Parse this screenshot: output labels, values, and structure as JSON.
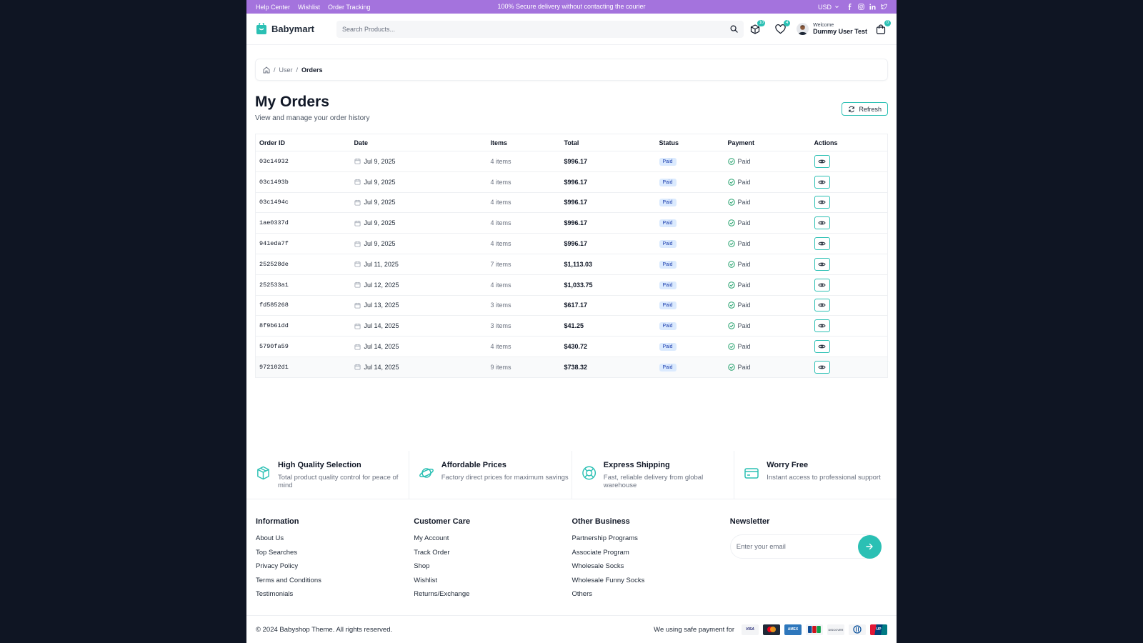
{
  "topbar": {
    "links": [
      "Help Center",
      "Wishlist",
      "Order Tracking"
    ],
    "promo": "100% Secure delivery without contacting the courier",
    "currency": "USD",
    "socials": [
      "facebook-icon",
      "instagram-icon",
      "linkedin-icon",
      "twitter-icon"
    ]
  },
  "header": {
    "logo": "Babymart",
    "search_placeholder": "Search Products...",
    "compare_count": "10",
    "wishlist_count": "4",
    "cart_count": "0",
    "welcome": "Welcome",
    "user_name": "Dummy User Test"
  },
  "breadcrumb": {
    "home_icon": "home-icon",
    "user": "User",
    "current": "Orders"
  },
  "page": {
    "title": "My Orders",
    "subtitle": "View and manage your order history",
    "refresh_label": "Refresh"
  },
  "table": {
    "headers": [
      "Order ID",
      "Date",
      "Items",
      "Total",
      "Status",
      "Payment",
      "Actions"
    ],
    "rows": [
      {
        "id": "03c14932",
        "date": "Jul 9, 2025",
        "items": "4 items",
        "total": "$996.17",
        "status": "Paid",
        "payment": "Paid"
      },
      {
        "id": "03c1493b",
        "date": "Jul 9, 2025",
        "items": "4 items",
        "total": "$996.17",
        "status": "Paid",
        "payment": "Paid"
      },
      {
        "id": "03c1494c",
        "date": "Jul 9, 2025",
        "items": "4 items",
        "total": "$996.17",
        "status": "Paid",
        "payment": "Paid"
      },
      {
        "id": "1ae0337d",
        "date": "Jul 9, 2025",
        "items": "4 items",
        "total": "$996.17",
        "status": "Paid",
        "payment": "Paid"
      },
      {
        "id": "941eda7f",
        "date": "Jul 9, 2025",
        "items": "4 items",
        "total": "$996.17",
        "status": "Paid",
        "payment": "Paid"
      },
      {
        "id": "252528de",
        "date": "Jul 11, 2025",
        "items": "7 items",
        "total": "$1,113.03",
        "status": "Paid",
        "payment": "Paid"
      },
      {
        "id": "252533a1",
        "date": "Jul 12, 2025",
        "items": "4 items",
        "total": "$1,033.75",
        "status": "Paid",
        "payment": "Paid"
      },
      {
        "id": "fd585268",
        "date": "Jul 13, 2025",
        "items": "3 items",
        "total": "$617.17",
        "status": "Paid",
        "payment": "Paid"
      },
      {
        "id": "8f9b61dd",
        "date": "Jul 14, 2025",
        "items": "3 items",
        "total": "$41.25",
        "status": "Paid",
        "payment": "Paid"
      },
      {
        "id": "5790fa59",
        "date": "Jul 14, 2025",
        "items": "4 items",
        "total": "$430.72",
        "status": "Paid",
        "payment": "Paid"
      },
      {
        "id": "972102d1",
        "date": "Jul 14, 2025",
        "items": "9 items",
        "total": "$738.32",
        "status": "Paid",
        "payment": "Paid"
      }
    ]
  },
  "features": [
    {
      "icon": "box-icon",
      "title": "High Quality Selection",
      "desc": "Total product quality control for peace of mind"
    },
    {
      "icon": "planet-icon",
      "title": "Affordable Prices",
      "desc": "Factory direct prices for maximum savings"
    },
    {
      "icon": "lifebuoy-icon",
      "title": "Express Shipping",
      "desc": "Fast, reliable delivery from global warehouse"
    },
    {
      "icon": "credit-card-icon",
      "title": "Worry Free",
      "desc": "Instant access to professional support"
    }
  ],
  "footer": {
    "columns": [
      {
        "title": "Information",
        "links": [
          "About Us",
          "Top Searches",
          "Privacy Policy",
          "Terms and Conditions",
          "Testimonials"
        ]
      },
      {
        "title": "Customer Care",
        "links": [
          "My Account",
          "Track Order",
          "Shop",
          "Wishlist",
          "Returns/Exchange"
        ]
      },
      {
        "title": "Other Business",
        "links": [
          "Partnership Programs",
          "Associate Program",
          "Wholesale Socks",
          "Wholesale Funny Socks",
          "Others"
        ]
      }
    ],
    "newsletter_title": "Newsletter",
    "newsletter_placeholder": "Enter your email",
    "copyright": "© 2024 Babyshop Theme. All rights reserved.",
    "payment_text": "We using safe payment for",
    "payment_cards": [
      "visa",
      "mastercard",
      "amex",
      "jcb",
      "discover",
      "diners",
      "unionpay"
    ]
  },
  "colors": {
    "accent": "#2bc0b4",
    "topbar": "#a473dd",
    "status_bg": "#dbeafe",
    "status_text": "#1e40af",
    "paid_check": "#22a06b"
  }
}
